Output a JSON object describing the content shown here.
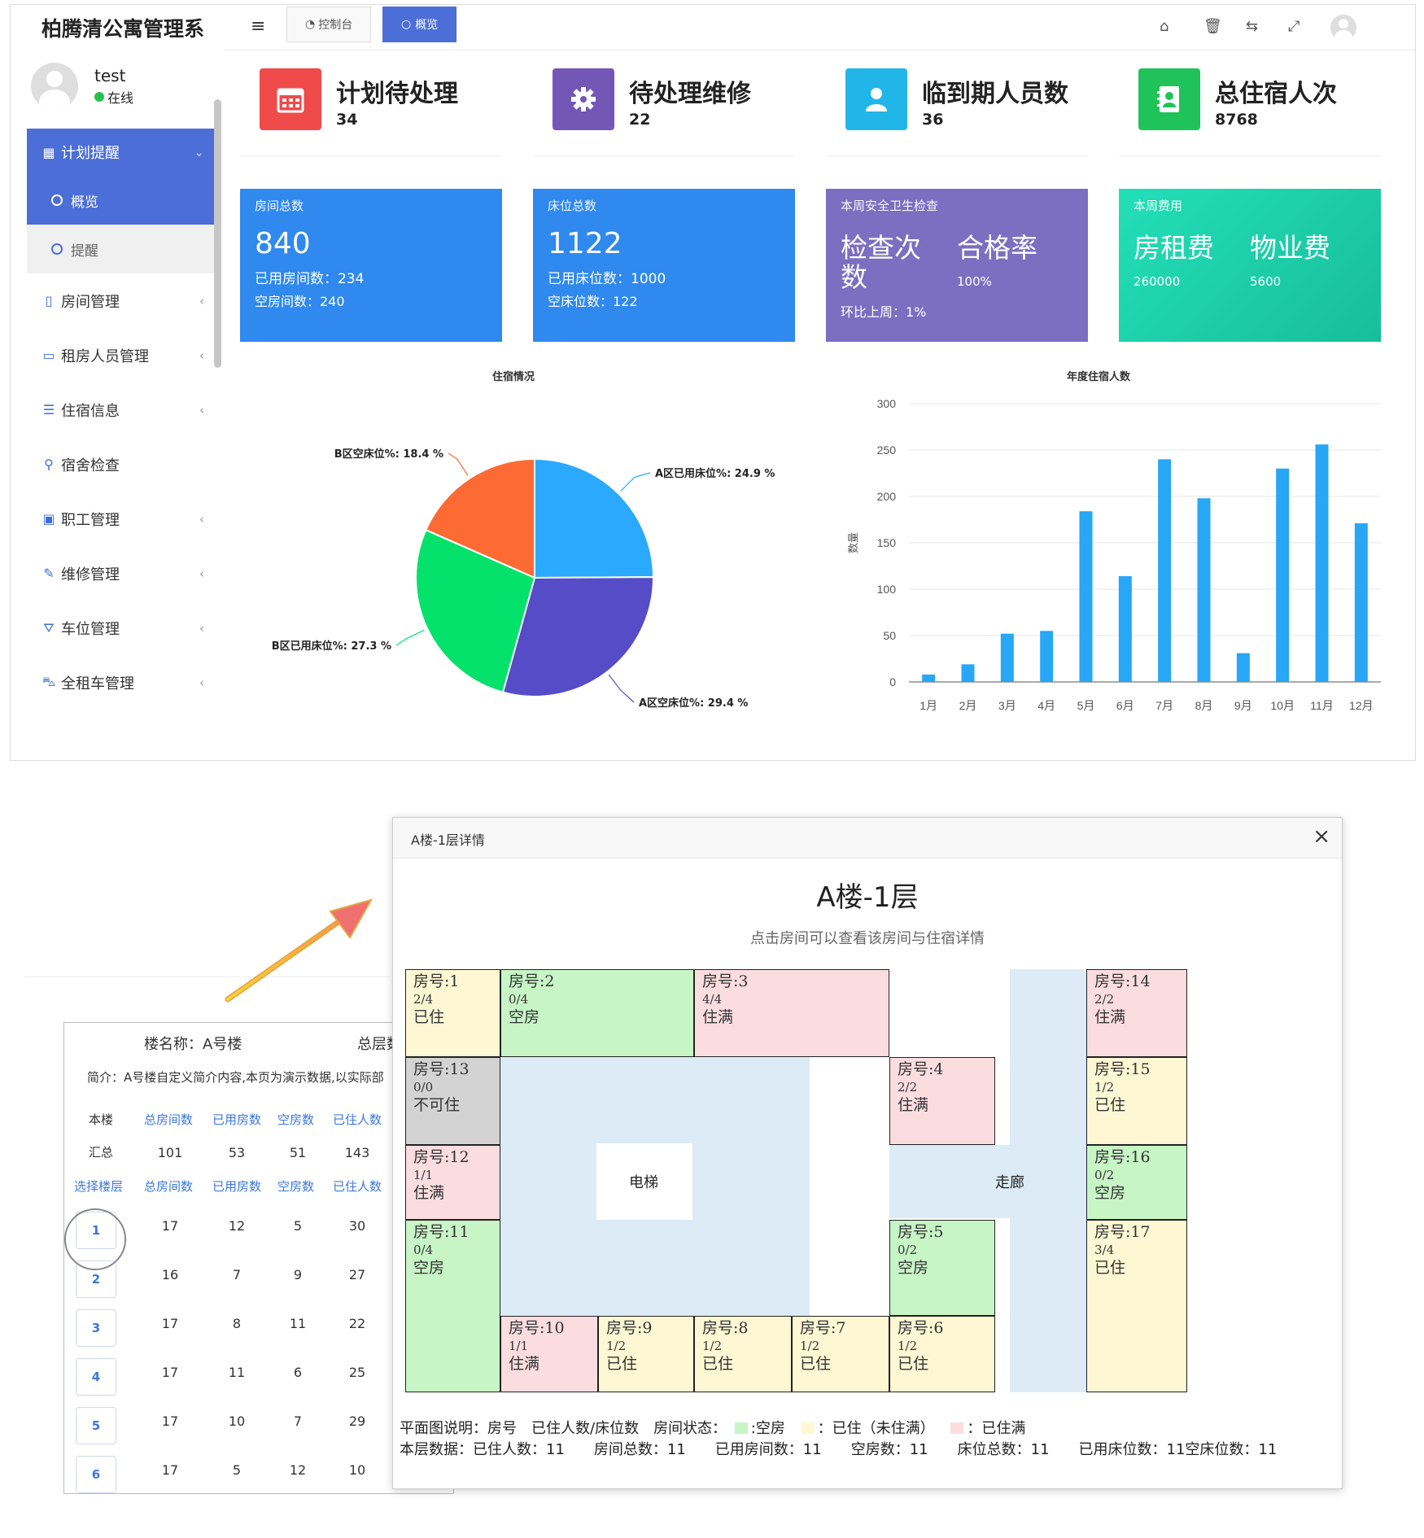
{
  "app": {
    "brand": "柏腾清公寓管理系"
  },
  "user": {
    "name": "test",
    "status": "在线"
  },
  "sidebar": {
    "items": [
      {
        "label": "计划提醒",
        "icon": "calendar-icon"
      },
      {
        "label": "房间管理",
        "icon": "building-icon"
      },
      {
        "label": "租房人员管理",
        "icon": "id-card-icon"
      },
      {
        "label": "住宿信息",
        "icon": "list-icon"
      },
      {
        "label": "宿舍检查",
        "icon": "search-icon"
      },
      {
        "label": "职工管理",
        "icon": "contact-icon"
      },
      {
        "label": "维修管理",
        "icon": "wrench-icon"
      },
      {
        "label": "车位管理",
        "icon": "road-icon"
      },
      {
        "label": "全租车管理",
        "icon": "car-icon"
      }
    ],
    "sub_items": [
      {
        "label": "概览"
      },
      {
        "label": "提醒"
      }
    ]
  },
  "topbar": {
    "tabs": [
      {
        "label": "控制台"
      },
      {
        "label": "概览"
      }
    ],
    "icons": [
      "home-icon",
      "trash-icon",
      "translate-icon",
      "fullscreen-icon",
      "user-avatar-icon"
    ]
  },
  "stats": [
    {
      "title": "计划待处理",
      "value": "34",
      "color": "#ef4b4b",
      "icon": "calendar-icon"
    },
    {
      "title": "待处理维修",
      "value": "22",
      "color": "#7257b6",
      "icon": "gear-icon"
    },
    {
      "title": "临到期人员数",
      "value": "36",
      "color": "#22b6e8",
      "icon": "person-icon"
    },
    {
      "title": "总住宿人次",
      "value": "8768",
      "color": "#20c35a",
      "icon": "address-book-icon"
    }
  ],
  "cards": {
    "rooms": {
      "label": "房间总数",
      "total": "840",
      "used": "已用房间数：234",
      "empty": "空房间数：240",
      "color": "#2f89ee"
    },
    "beds": {
      "label": "床位总数",
      "total": "1122",
      "used": "已用床位数：1000",
      "empty": "空床位数：122",
      "color": "#2f89ee"
    },
    "safety": {
      "label": "本周安全卫生检查",
      "h1": "检查次数",
      "h2": "合格率",
      "v2": "100%",
      "foot": "环比上周：1%",
      "color": "#7c6ec0"
    },
    "fees": {
      "label": "本周费用",
      "h1": "房租费",
      "v1": "260000",
      "h2": "物业费",
      "v2": "5600",
      "color": "#20d0a8"
    }
  },
  "chart_data": [
    {
      "type": "pie",
      "title": "住宿情况",
      "slices": [
        {
          "label": "A区已用床位%: 24.9 %",
          "value": 24.9,
          "color": "#2aa9ff"
        },
        {
          "label": "A区空床位%: 29.4 %",
          "value": 29.4,
          "color": "#564cc7"
        },
        {
          "label": "B区已用床位%: 27.3 %",
          "value": 27.3,
          "color": "#05e26c"
        },
        {
          "label": "B区空床位%: 18.4 %",
          "value": 18.4,
          "color": "#fe6a33"
        }
      ]
    },
    {
      "type": "bar",
      "title": "年度住宿人数",
      "ylabel": "数量",
      "ylim": [
        0,
        300
      ],
      "yticks": [
        0,
        50,
        100,
        150,
        200,
        250,
        300
      ],
      "categories": [
        "1月",
        "2月",
        "3月",
        "4月",
        "5月",
        "6月",
        "7月",
        "8月",
        "9月",
        "10月",
        "11月",
        "12月"
      ],
      "values": [
        8,
        19,
        52,
        55,
        184,
        114,
        240,
        198,
        31,
        230,
        256,
        171
      ],
      "color": "#27a7f5"
    }
  ],
  "building": {
    "name": "楼名称：A号楼",
    "total_floors": "总层数",
    "intro": "简介：A号楼自定义简介内容,本页为演示数据,以实际部",
    "row_label_this": "本楼",
    "row_label_sum": "汇总",
    "headers": [
      "总房间数",
      "已用房数",
      "空房数",
      "已住人数"
    ],
    "select_floor": "选择楼层",
    "summary": [
      "101",
      "53",
      "51",
      "143"
    ],
    "floors": [
      {
        "floor": "1",
        "values": [
          "17",
          "12",
          "5",
          "30"
        ]
      },
      {
        "floor": "2",
        "values": [
          "16",
          "7",
          "9",
          "27"
        ]
      },
      {
        "floor": "3",
        "values": [
          "17",
          "8",
          "11",
          "22"
        ]
      },
      {
        "floor": "4",
        "values": [
          "17",
          "11",
          "6",
          "25"
        ]
      },
      {
        "floor": "5",
        "values": [
          "17",
          "10",
          "7",
          "29"
        ]
      },
      {
        "floor": "6",
        "values": [
          "17",
          "5",
          "12",
          "10"
        ]
      }
    ]
  },
  "modal": {
    "header": "A楼-1层详情",
    "close": "×",
    "title": "A楼-1层",
    "subtitle": "点击房间可以查看该房间与住宿详情",
    "elevator": "电梯",
    "corridor": "走廊",
    "rooms": [
      {
        "no": "房号:1",
        "count": "2/4",
        "status": "已住"
      },
      {
        "no": "房号:2",
        "count": "0/4",
        "status": "空房"
      },
      {
        "no": "房号:3",
        "count": "4/4",
        "status": "住满"
      },
      {
        "no": "房号:14",
        "count": "2/2",
        "status": "住满"
      },
      {
        "no": "房号:13",
        "count": "0/0",
        "status": "不可住"
      },
      {
        "no": "房号:4",
        "count": "2/2",
        "status": "住满"
      },
      {
        "no": "房号:15",
        "count": "1/2",
        "status": "已住"
      },
      {
        "no": "房号:12",
        "count": "1/1",
        "status": "住满"
      },
      {
        "no": "房号:16",
        "count": "0/2",
        "status": "空房"
      },
      {
        "no": "房号:11",
        "count": "0/4",
        "status": "空房"
      },
      {
        "no": "房号:5",
        "count": "0/2",
        "status": "空房"
      },
      {
        "no": "房号:17",
        "count": "3/4",
        "status": "已住"
      },
      {
        "no": "房号:10",
        "count": "1/1",
        "status": "住满"
      },
      {
        "no": "房号:9",
        "count": "1/2",
        "status": "已住"
      },
      {
        "no": "房号:8",
        "count": "1/2",
        "status": "已住"
      },
      {
        "no": "房号:7",
        "count": "1/2",
        "status": "已住"
      },
      {
        "no": "房号:6",
        "count": "1/2",
        "status": "已住"
      }
    ],
    "legend": {
      "prefix": "平面图说明：房号　已住人数/床位数　房间状态：",
      "empty": ":空房",
      "partial": "：已住（未住满）",
      "full": "：已住满"
    },
    "floor_stats": "本层数据：已住人数：11　　房间总数：11　　已用房间数：11　　空房数：11　　床位总数：11　　已用床位数：11空床位数：11"
  }
}
